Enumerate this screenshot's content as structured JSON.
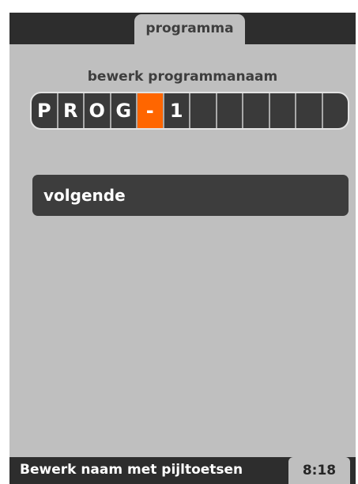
{
  "header": {
    "tab_title": "programma"
  },
  "editor": {
    "label": "bewerk programmanaam",
    "characters": [
      "P",
      "R",
      "O",
      "G",
      "-",
      "1",
      "",
      "",
      "",
      "",
      "",
      ""
    ],
    "active_index": 4
  },
  "next_button": {
    "label": "volgende"
  },
  "status_bar": {
    "hint": "Bewerk naam met pijltoetsen",
    "time": "8:18"
  },
  "colors": {
    "accent": "#ff6600",
    "frame": "#2d2d2d",
    "background": "#bfbfbf"
  }
}
